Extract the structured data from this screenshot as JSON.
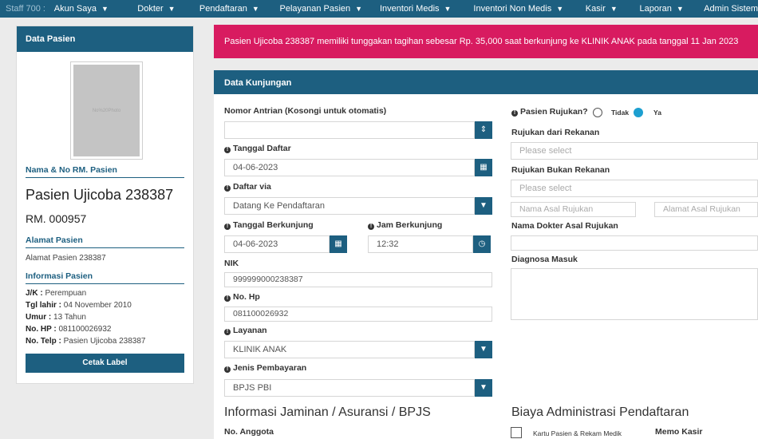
{
  "nav": {
    "staff": "Staff 700 :",
    "items": [
      {
        "label": "Akun Saya"
      },
      {
        "label": "Dokter"
      },
      {
        "label": "Pendaftaran"
      },
      {
        "label": "Pelayanan Pasien"
      },
      {
        "label": "Inventori Medis"
      },
      {
        "label": "Inventori Non Medis"
      },
      {
        "label": "Kasir"
      },
      {
        "label": "Laporan"
      },
      {
        "label": "Admin Sistem"
      }
    ]
  },
  "patient_panel": {
    "header": "Data Pasien",
    "photo_text": "No%20Photo",
    "name_label": "Nama & No RM. Pasien",
    "name": "Pasien Ujicoba 238387",
    "rm": "RM. 000957",
    "address_label": "Alamat Pasien",
    "address": "Alamat Pasien 238387",
    "info_label": "Informasi Pasien",
    "info": [
      {
        "key": "J/K :",
        "value": " Perempuan"
      },
      {
        "key": "Tgl lahir :",
        "value": " 04 November 2010"
      },
      {
        "key": "Umur :",
        "value": " 13 Tahun"
      },
      {
        "key": "No. HP :",
        "value": " 081100026932"
      },
      {
        "key": "No. Telp :",
        "value": " Pasien Ujicoba 238387"
      }
    ],
    "print_button": "Cetak Label"
  },
  "alert": "Pasien Ujicoba 238387 memiliki tunggakan tagihan sebesar Rp. 35,000 saat berkunjung ke KLINIK ANAK pada tanggal 11 Jan 2023",
  "form": {
    "header": "Data Kunjungan",
    "queue_label": "Nomor Antrian (Kosongi untuk otomatis)",
    "queue_value": "",
    "reg_date_label": "Tanggal Daftar",
    "reg_date": "04-06-2023",
    "via_label": "Daftar via",
    "via_value": "Datang Ke Pendaftaran",
    "visit_date_label": "Tanggal Berkunjung",
    "visit_date": "04-06-2023",
    "visit_time_label": "Jam Berkunjung",
    "visit_time": "12:32",
    "nik_label": "NIK",
    "nik": "999999000238387",
    "hp_label": "No. Hp",
    "hp": "081100026932",
    "service_label": "Layanan",
    "service": "KLINIK ANAK",
    "payment_label": "Jenis Pembayaran",
    "payment": "BPJS PBI",
    "referral_label": "Pasien Rujukan?",
    "referral_no": "Tidak",
    "referral_yes": "Ya",
    "partner_label": "Rujukan dari Rekanan",
    "partner_placeholder": "Please select",
    "nonpartner_label": "Rujukan Bukan Rekanan",
    "nonpartner_placeholder": "Please select",
    "origin_name_placeholder": "Nama Asal Rujukan",
    "origin_address_placeholder": "Alamat Asal Rujukan",
    "doctor_label": "Nama Dokter Asal Rujukan",
    "diagnosis_label": "Diagnosa Masuk",
    "insurance_title": "Informasi Jaminan / Asuransi / BPJS",
    "member_no_label": "No. Anggota",
    "admin_fee_title": "Biaya Administrasi Pendaftaran",
    "card_checkbox_label": "Kartu Pasien & Rekam Medik",
    "cashier_memo_label": "Memo Kasir"
  }
}
